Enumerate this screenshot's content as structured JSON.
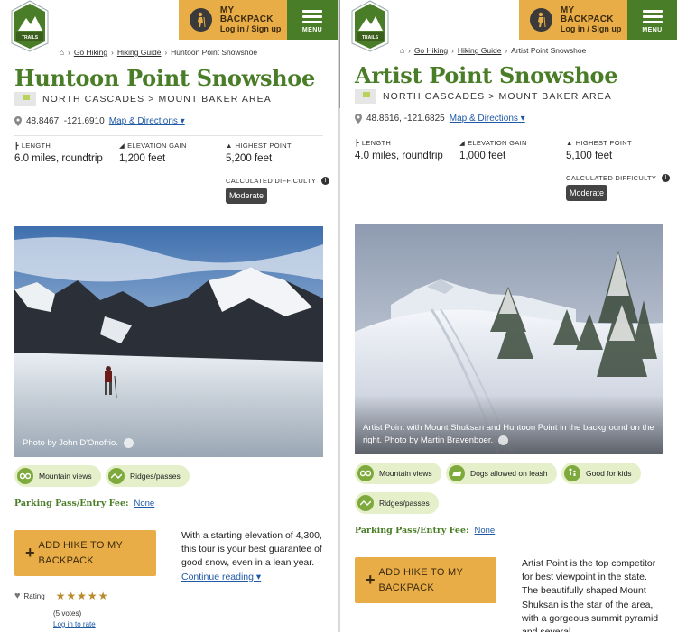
{
  "header": {
    "logo_text": "WASHINGTON TRAILS ASSOCIATION",
    "backpack_title": "MY BACKPACK",
    "backpack_sub": "Log in / Sign up",
    "menu_label": "MENU"
  },
  "left": {
    "breadcrumb": [
      "Go Hiking",
      "Hiking Guide",
      "Huntoon Point Snowshoe"
    ],
    "title": "Huntoon Point Snowshoe",
    "region": "NORTH CASCADES > MOUNT BAKER AREA",
    "coords": "48.8467, -121.6910",
    "map_link": "Map & Directions",
    "stats": {
      "length_label": "LENGTH",
      "length": "6.0 miles, roundtrip",
      "gain_label": "ELEVATION GAIN",
      "gain": "1,200 feet",
      "high_label": "HIGHEST POINT",
      "high": "5,200 feet",
      "difficulty_label": "CALCULATED DIFFICULTY",
      "difficulty": "Moderate"
    },
    "photo_caption": "Photo by John D'Onofrio.",
    "features": [
      "Mountain views",
      "Ridges/passes"
    ],
    "fee_label": "Parking Pass/Entry Fee:",
    "fee_value": "None",
    "add_button": [
      "ADD HIKE TO MY",
      "BACKPACK"
    ],
    "description": "With a starting elevation of 4,300, this tour is your best guarantee of good snow, even in a lean year.",
    "continue": "Continue reading",
    "rating_label": "Rating",
    "rating_stars": 5,
    "votes": "(5 votes)",
    "login_rate": "Log in to rate"
  },
  "right": {
    "breadcrumb": [
      "Go Hiking",
      "Hiking Guide",
      "Artist Point Snowshoe"
    ],
    "title": "Artist Point Snowshoe",
    "region": "NORTH CASCADES > MOUNT BAKER AREA",
    "coords": "48.8616, -121.6825",
    "map_link": "Map & Directions",
    "stats": {
      "length_label": "LENGTH",
      "length": "4.0 miles, roundtrip",
      "gain_label": "ELEVATION GAIN",
      "gain": "1,000 feet",
      "high_label": "HIGHEST POINT",
      "high": "5,100 feet",
      "difficulty_label": "CALCULATED DIFFICULTY",
      "difficulty": "Moderate"
    },
    "photo_caption": "Artist Point with Mount Shuksan and Huntoon Point in the background on the right. Photo by Martin Bravenboer.",
    "features": [
      "Mountain views",
      "Dogs allowed on leash",
      "Good for kids",
      "Ridges/passes"
    ],
    "fee_label": "Parking Pass/Entry Fee:",
    "fee_value": "None",
    "add_button": [
      "ADD HIKE TO MY",
      "BACKPACK"
    ],
    "description": "Artist Point is the top competitor for best viewpoint in the state. The beautifully shaped Mount Shuksan is the star of the area, with a gorgeous summit pyramid and several"
  },
  "colors": {
    "green": "#4a7d27",
    "gold": "#e8ad47",
    "link": "#1f5aa6",
    "feature_bg": "#e5efc9"
  }
}
